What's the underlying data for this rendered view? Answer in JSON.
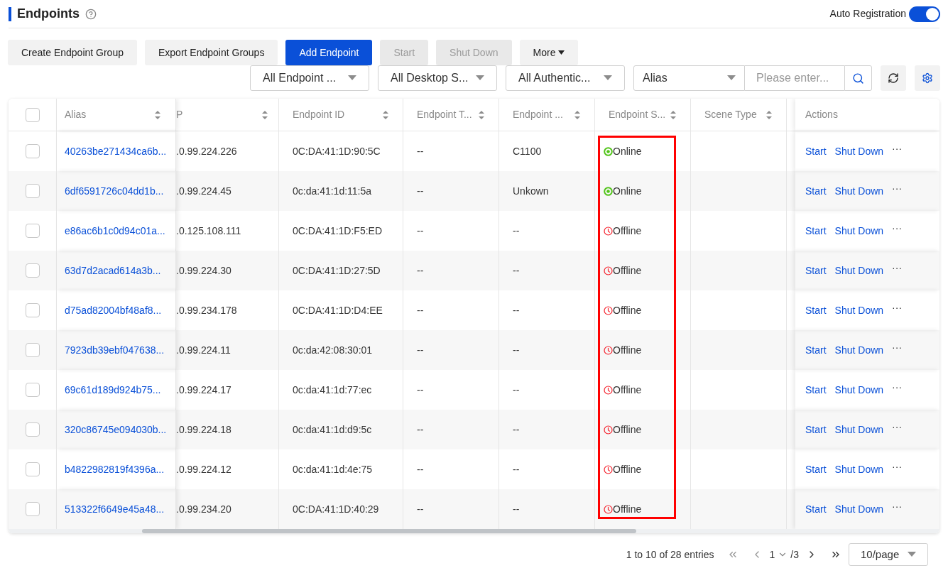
{
  "header": {
    "title": "Endpoints",
    "toggle": {
      "label": "Auto Registration",
      "on": true
    }
  },
  "toolbar": [
    {
      "label": "Create Endpoint Group",
      "kind": "default"
    },
    {
      "label": "Export Endpoint Groups",
      "kind": "default"
    },
    {
      "label": "Add Endpoint",
      "kind": "primary"
    },
    {
      "label": "Start",
      "kind": "disabled"
    },
    {
      "label": "Shut Down",
      "kind": "disabled"
    },
    {
      "label": "More",
      "kind": "dropdown"
    }
  ],
  "filters": [
    {
      "value": "All Endpoint ..."
    },
    {
      "value": "All Desktop S..."
    },
    {
      "value": "All Authentic..."
    }
  ],
  "search": {
    "field": "Alias",
    "placeholder": "Please enter..."
  },
  "table": {
    "select_all": {
      "checked": false
    },
    "columns": [
      "Alias",
      "P",
      "Endpoint ID",
      "Endpoint T...",
      "Endpoint ...",
      "Endpoint S...",
      "Scene Type",
      "Actions"
    ],
    "rows": [
      {
        "selected": false,
        "alias": "40263be271434ca6b...",
        "ip": ".0.99.224.226",
        "endpoint_id": "0C:DA:41:1D:90:5C",
        "column_4": "--",
        "column_5": "C1100",
        "status": "Online",
        "kind": "online",
        "actions": [
          "Start",
          "Shut Down",
          "···"
        ]
      },
      {
        "selected": false,
        "alias": "6df6591726c04dd1b...",
        "ip": ".0.99.224.45",
        "endpoint_id": "0c:da:41:1d:11:5a",
        "column_4": "--",
        "column_5": "Unkown",
        "status": "Online",
        "kind": "online",
        "actions": [
          "Start",
          "Shut Down",
          "···"
        ]
      },
      {
        "selected": false,
        "alias": "e86ac6b1c0d94c01a...",
        "ip": ".0.125.108.111",
        "endpoint_id": "0C:DA:41:1D:F5:ED",
        "column_4": "--",
        "column_5": "--",
        "status": "Offline",
        "kind": "offline",
        "actions": [
          "Start",
          "Shut Down",
          "···"
        ]
      },
      {
        "selected": false,
        "alias": "63d7d2acad614a3b...",
        "ip": ".0.99.224.30",
        "endpoint_id": "0C:DA:41:1D:27:5D",
        "column_4": "--",
        "column_5": "--",
        "status": "Offline",
        "kind": "offline",
        "actions": [
          "Start",
          "Shut Down",
          "···"
        ]
      },
      {
        "selected": false,
        "alias": "d75ad82004bf48af8...",
        "ip": ".0.99.234.178",
        "endpoint_id": "0C:DA:41:1D:D4:EE",
        "column_4": "--",
        "column_5": "--",
        "status": "Offline",
        "kind": "offline",
        "actions": [
          "Start",
          "Shut Down",
          "···"
        ]
      },
      {
        "selected": false,
        "alias": "7923db39ebf047638...",
        "ip": ".0.99.224.11",
        "endpoint_id": "0c:da:42:08:30:01",
        "column_4": "--",
        "column_5": "--",
        "status": "Offline",
        "kind": "offline",
        "actions": [
          "Start",
          "Shut Down",
          "···"
        ]
      },
      {
        "selected": false,
        "alias": "69c61d189d924b75...",
        "ip": ".0.99.224.17",
        "endpoint_id": "0c:da:41:1d:77:ec",
        "column_4": "--",
        "column_5": "--",
        "status": "Offline",
        "kind": "offline",
        "actions": [
          "Start",
          "Shut Down",
          "···"
        ]
      },
      {
        "selected": false,
        "alias": "320c86745e094030b...",
        "ip": ".0.99.224.18",
        "endpoint_id": "0c:da:41:1d:d9:5c",
        "column_4": "--",
        "column_5": "--",
        "status": "Offline",
        "kind": "offline",
        "actions": [
          "Start",
          "Shut Down",
          "···"
        ]
      },
      {
        "selected": false,
        "alias": "b4822982819f4396a...",
        "ip": ".0.99.224.12",
        "endpoint_id": "0c:da:41:1d:4e:75",
        "column_4": "--",
        "column_5": "--",
        "status": "Offline",
        "kind": "offline",
        "actions": [
          "Start",
          "Shut Down",
          "···"
        ]
      },
      {
        "selected": false,
        "alias": "513322f6649e45a48...",
        "ip": ".0.99.234.20",
        "endpoint_id": "0C:DA:41:1D:40:29",
        "column_4": "--",
        "column_5": "--",
        "status": "Offline",
        "kind": "offline",
        "actions": [
          "Start",
          "Shut Down",
          "···"
        ]
      }
    ]
  },
  "pagination": {
    "summary": "1 to 10 of 28 entries",
    "page": "1",
    "total": "/3",
    "page_size": "10/page"
  }
}
